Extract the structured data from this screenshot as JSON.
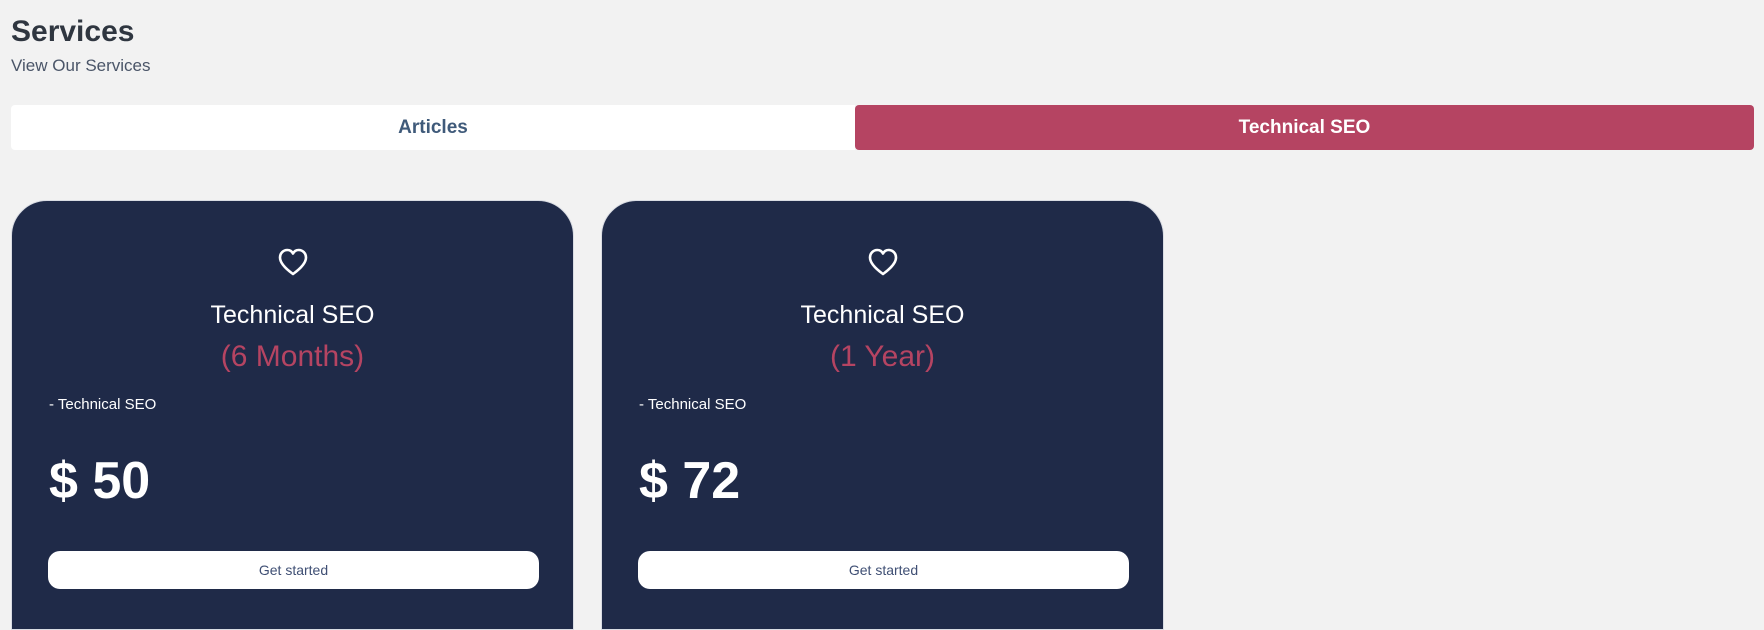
{
  "header": {
    "title": "Services",
    "subtitle": "View Our Services"
  },
  "tabs": [
    {
      "label": "Articles",
      "active": false
    },
    {
      "label": "Technical SEO",
      "active": true
    }
  ],
  "colors": {
    "accent": "#b54462",
    "card_background": "#1f2a48",
    "page_background": "#f2f2f2"
  },
  "cards": [
    {
      "icon": "heart-icon",
      "name": "Technical SEO",
      "duration": "(6 Months)",
      "feature": "- Technical SEO",
      "price": "$ 50",
      "button_label": "Get started"
    },
    {
      "icon": "heart-icon",
      "name": "Technical SEO",
      "duration": "(1 Year)",
      "feature": "- Technical SEO",
      "price": "$ 72",
      "button_label": "Get started"
    }
  ]
}
